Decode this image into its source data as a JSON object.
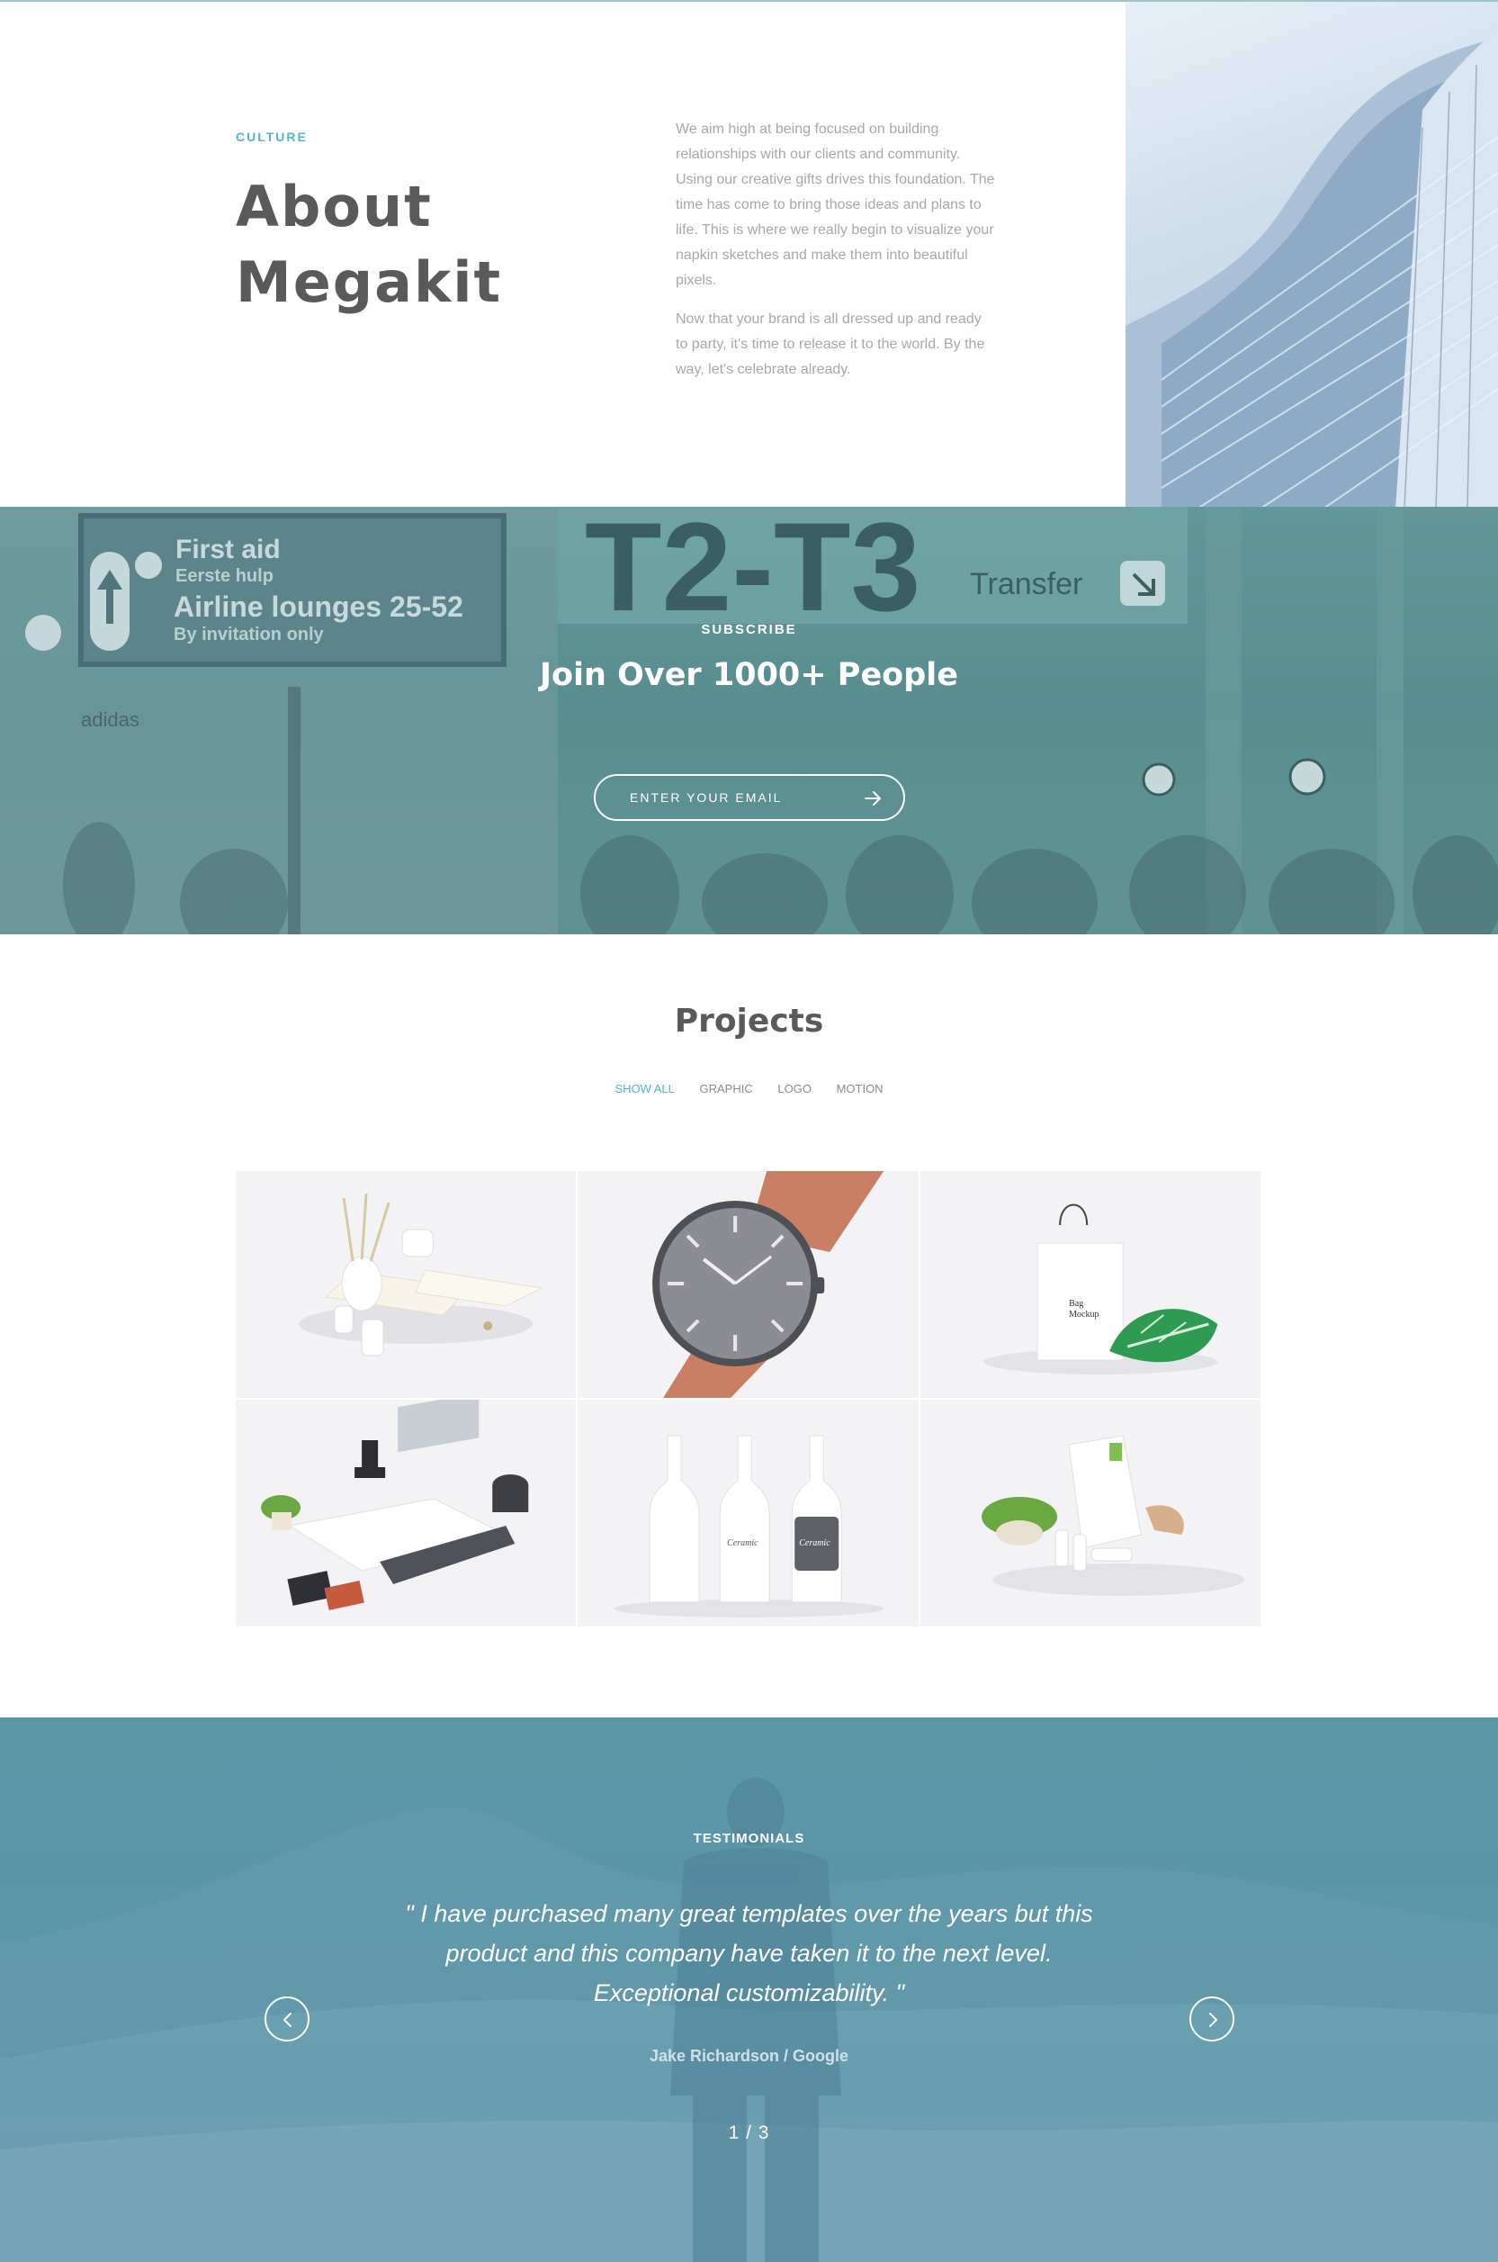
{
  "about": {
    "eyebrow": "CULTURE",
    "title": "About Megakit",
    "paragraph_1": "We aim high at being focused on building relationships with our clients and community. Using our creative gifts drives this foundation. The time has come to bring those ideas and plans to life. This is where we really begin to visualize your napkin sketches and make them into beautiful pixels.",
    "paragraph_2": "Now that your brand is all dressed up and ready to party, it's time to release it to the world. By the way, let's celebrate already."
  },
  "subscribe": {
    "eyebrow": "SUBSCRIBE",
    "title": "Join Over 1000+ People",
    "email_placeholder": "ENTER YOUR EMAIL",
    "bg_signage": {
      "first_aid": "First aid",
      "first_aid_sub": "Eerste hulp",
      "lounges": "Airline lounges 25-52",
      "lounges_sub": "By invitation only",
      "terminal": "T2-T3",
      "transfer": "Transfer",
      "brand": "adidas"
    }
  },
  "projects": {
    "title": "Projects",
    "filters": [
      {
        "label": "SHOW ALL",
        "active": true
      },
      {
        "label": "GRAPHIC",
        "active": false
      },
      {
        "label": "LOGO",
        "active": false
      },
      {
        "label": "MOTION",
        "active": false
      }
    ],
    "items": [
      {
        "name": "diffuser-mockup"
      },
      {
        "name": "watch-mockup"
      },
      {
        "name": "bag-mockup",
        "label_line1": "Bag",
        "label_line2": "Mockup"
      },
      {
        "name": "stationery-mockup"
      },
      {
        "name": "bottles-mockup",
        "bottle_label": "Ceramic"
      },
      {
        "name": "coffee-bag-mockup"
      }
    ]
  },
  "testimonials": {
    "eyebrow": "TESTIMONIALS",
    "quote": "\" I have purchased many great templates over the years but this product and this company have taken it to the next level. Exceptional customizability. \"",
    "author": "Jake Richardson / Google",
    "pager": "1 / 3"
  },
  "colors": {
    "accent": "#4fb7c7",
    "heading": "#5a5a5a",
    "body_text": "#a8a8a8",
    "subscribe_overlay": "#5f9398",
    "testimonials_overlay": "#5c95aa"
  }
}
